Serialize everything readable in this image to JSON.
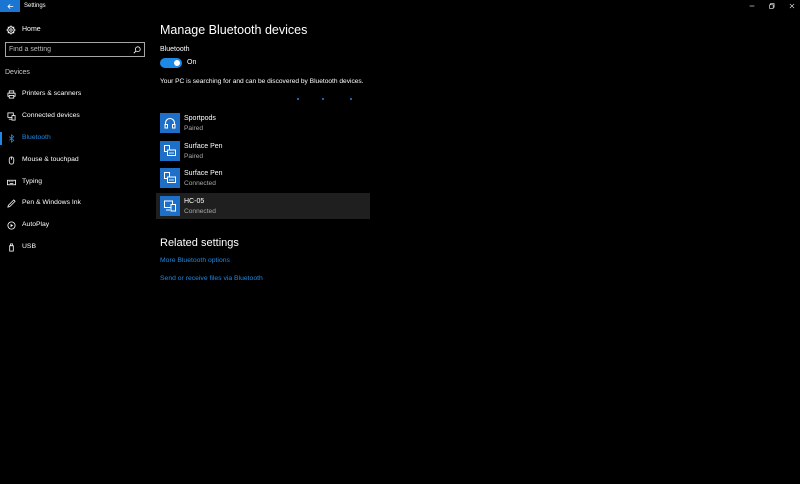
{
  "window": {
    "title": "Settings",
    "back_icon": "back-arrow-icon",
    "controls": [
      "minimize-icon",
      "maximize-icon",
      "close-icon"
    ]
  },
  "sidebar": {
    "home_label": "Home",
    "search_placeholder": "Find a setting",
    "section_heading": "Devices",
    "items": [
      {
        "label": "Printers & scanners",
        "icon": "printer-icon"
      },
      {
        "label": "Connected devices",
        "icon": "connected-devices-icon"
      },
      {
        "label": "Bluetooth",
        "icon": "bluetooth-icon",
        "active": true
      },
      {
        "label": "Mouse & touchpad",
        "icon": "mouse-icon"
      },
      {
        "label": "Typing",
        "icon": "keyboard-icon"
      },
      {
        "label": "Pen & Windows Ink",
        "icon": "pen-icon"
      },
      {
        "label": "AutoPlay",
        "icon": "autoplay-icon"
      },
      {
        "label": "USB",
        "icon": "usb-icon"
      }
    ]
  },
  "main": {
    "title": "Manage Bluetooth devices",
    "bluetooth_label": "Bluetooth",
    "toggle_state": "On",
    "description": "Your PC is searching for and can be discovered by Bluetooth devices.",
    "devices": [
      {
        "name": "Sportpods",
        "status": "Paired",
        "icon": "headphones-icon"
      },
      {
        "name": "Surface Pen",
        "status": "Paired",
        "icon": "pen-device-icon"
      },
      {
        "name": "Surface Pen",
        "status": "Connected",
        "icon": "pen-device-icon"
      },
      {
        "name": "HC-05",
        "status": "Connected",
        "icon": "computer-device-icon",
        "selected": true
      }
    ],
    "related_title": "Related settings",
    "links": [
      "More Bluetooth options",
      "Send or receive files via Bluetooth"
    ]
  },
  "colors": {
    "accent": "#1e88e5",
    "tile": "#1e6fc7",
    "background": "#000000",
    "selected_row": "#1f1f1f"
  }
}
